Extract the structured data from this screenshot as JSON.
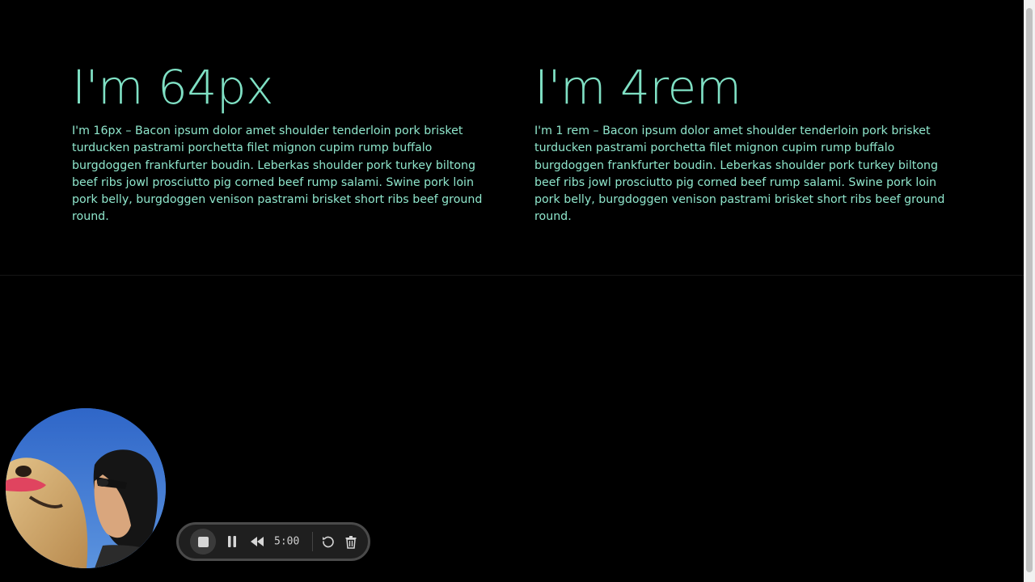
{
  "sections": [
    {
      "heading": "I'm 64px",
      "body": "I'm 16px – Bacon ipsum dolor amet shoulder tenderloin pork brisket turducken pastrami porchetta filet mignon cupim rump buffalo burgdoggen frankfurter boudin. Leberkas shoulder pork turkey biltong beef ribs jowl prosciutto pig corned beef rump salami. Swine pork loin pork belly, burgdoggen venison pastrami brisket short ribs beef ground round."
    },
    {
      "heading": "I'm 4rem",
      "body": "I'm 1 rem – Bacon ipsum dolor amet shoulder tenderloin pork brisket turducken pastrami porchetta filet mignon cupim rump buffalo burgdoggen frankfurter boudin. Leberkas shoulder pork turkey biltong beef ribs jowl prosciutto pig corned beef rump salami. Swine pork loin pork belly, burgdoggen venison pastrami brisket short ribs beef ground round."
    }
  ],
  "recorder": {
    "timer": "5:00",
    "icons": [
      "stop-icon",
      "pause-icon",
      "rewind-icon",
      "restart-icon",
      "trash-icon"
    ]
  },
  "colors": {
    "background": "#000000",
    "text_accent": "#7fe0c4"
  }
}
